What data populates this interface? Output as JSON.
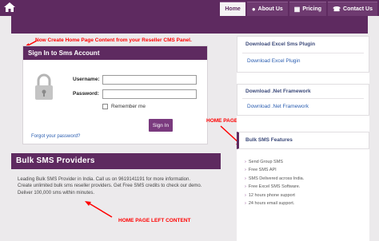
{
  "nav": {
    "home_label": "Home",
    "items": [
      {
        "label": "Home",
        "icon": "",
        "active": true
      },
      {
        "label": "About Us",
        "icon": "users-icon",
        "active": false
      },
      {
        "label": "Pricing",
        "icon": "grid-icon",
        "active": false
      },
      {
        "label": "Contact Us",
        "icon": "phone-icon",
        "active": false
      }
    ]
  },
  "annotations": {
    "top": "Now Create Home Page Content from your Reseller CMS Panel.",
    "right": "HOME PAGE RIGHT CONTENT",
    "left": "HOME PAGE LEFT CONTENT"
  },
  "login": {
    "title": "Sign In to Sms Account",
    "username_label": "Username:",
    "password_label": "Password:",
    "remember_label": "Remember me",
    "signin_label": "Sign In",
    "forgot_label": "Forgot your password?"
  },
  "bulk": {
    "title": "Bulk SMS Providers",
    "lines": [
      "Leading Bulk SMS Provider in India. Call us on 9619141191 for more information.",
      "Create unlimited bulk sms reseller providers. Get Free SMS credits to check our demo.",
      "Deliver 100,000 sms within minutes."
    ]
  },
  "right": {
    "excel": {
      "title": "Download Excel Sms Plugin",
      "link": "Download Excel Plugin"
    },
    "dotnet": {
      "title": "Download .Net Framework",
      "link": "Download .Net Framework"
    },
    "features_title": "Bulk SMS Features",
    "features": [
      "Send Group SMS",
      "Free SMS API",
      "SMS Delivered across India.",
      "Free Excel SMS Software.",
      "12 hours phone support",
      "24 hours email support."
    ]
  },
  "colors": {
    "brand": "#5e2a60",
    "annotation": "#ff0000",
    "link": "#2a5db0"
  }
}
